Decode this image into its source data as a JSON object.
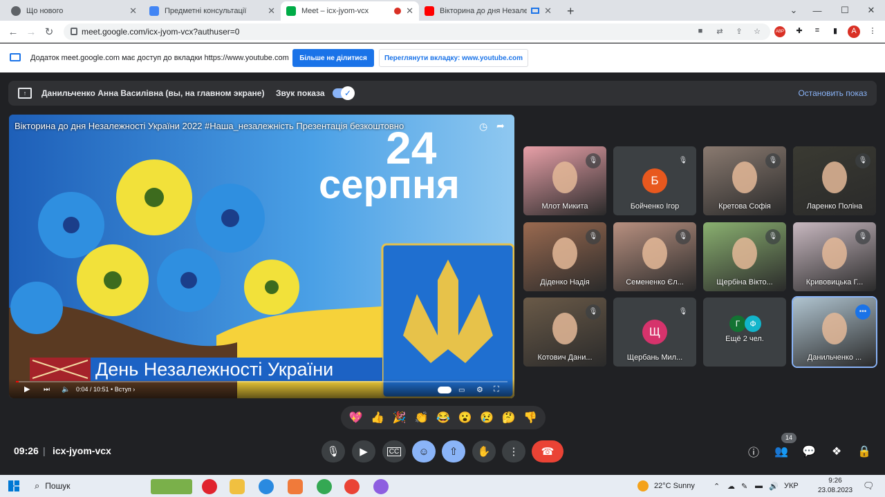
{
  "browser": {
    "tabs": [
      {
        "title": "Що нового",
        "color": "#5f6368"
      },
      {
        "title": "Предметні консультації",
        "color": "#4285f4"
      },
      {
        "title": "Meet – icx-jyom-vcx",
        "color": "#00ac47"
      },
      {
        "title": "Вікторина до дня Незалеж...",
        "color": "#ff0000"
      }
    ],
    "new_tab": "+",
    "url": "meet.google.com/icx-jyom-vcx?authuser=0",
    "profile_initial": "A"
  },
  "infobar": {
    "message": "Додаток meet.google.com має доступ до вкладки https://www.youtube.com",
    "stop_sharing": "Більше не ділитися",
    "view_tab": "Переглянути вкладку: www.youtube.com"
  },
  "sharebar": {
    "presenter": "Данильченко Анна Василівна (вы, на главном экране)",
    "sound_label": "Звук показа",
    "stop_label": "Остановить показ"
  },
  "video": {
    "title": "Вікторина до дня Незалежності України 2022 #Наша_незалежність Презентація безкоштовно",
    "date_number": "24",
    "date_month": "серпня",
    "banner": "День Незалежності України",
    "time": "0:04 / 10:51 • Вступ ›",
    "progress": 0.006
  },
  "participants": [
    {
      "name": "Млот Микита",
      "kind": "photo",
      "color": "#e8a0a8"
    },
    {
      "name": "Бойченко Ігор",
      "kind": "avatar",
      "initial": "Б",
      "color": "#e8581e"
    },
    {
      "name": "Кретова Софія",
      "kind": "photo",
      "color": "#8a7a70"
    },
    {
      "name": "Ларенко Поліна",
      "kind": "photo",
      "color": "#3a3a32"
    },
    {
      "name": "Діденко Надія",
      "kind": "photo",
      "color": "#9a6a50"
    },
    {
      "name": "Семененко Єл...",
      "kind": "photo",
      "color": "#b89080"
    },
    {
      "name": "Щербіна Вікто...",
      "kind": "photo",
      "color": "#8ab070"
    },
    {
      "name": "Кривовицька Г...",
      "kind": "photo",
      "color": "#c8b8c0"
    },
    {
      "name": "Котович Дани...",
      "kind": "photo",
      "color": "#6a5a48"
    },
    {
      "name": "Щербань Мил...",
      "kind": "avatar",
      "initial": "Щ",
      "color": "#d6336c"
    },
    {
      "name": "Ещё 2 чел.",
      "kind": "more",
      "initials": [
        "Г",
        "Ф"
      ],
      "colors": [
        "#137333",
        "#12b5cb"
      ]
    },
    {
      "name": "Данильченко ...",
      "kind": "photo",
      "color": "#b0c4d0"
    }
  ],
  "reactions": [
    "💖",
    "👍",
    "🎉",
    "👏",
    "😂",
    "😮",
    "😢",
    "🤔",
    "👎"
  ],
  "bottom": {
    "time": "09:26",
    "separator": "|",
    "meeting_code": "icx-jyom-vcx",
    "people_count": "14"
  },
  "taskbar": {
    "search": "Пошук",
    "weather": "22°C  Sunny",
    "lang": "УКР",
    "clock_time": "9:26",
    "clock_date": "23.08.2023"
  }
}
